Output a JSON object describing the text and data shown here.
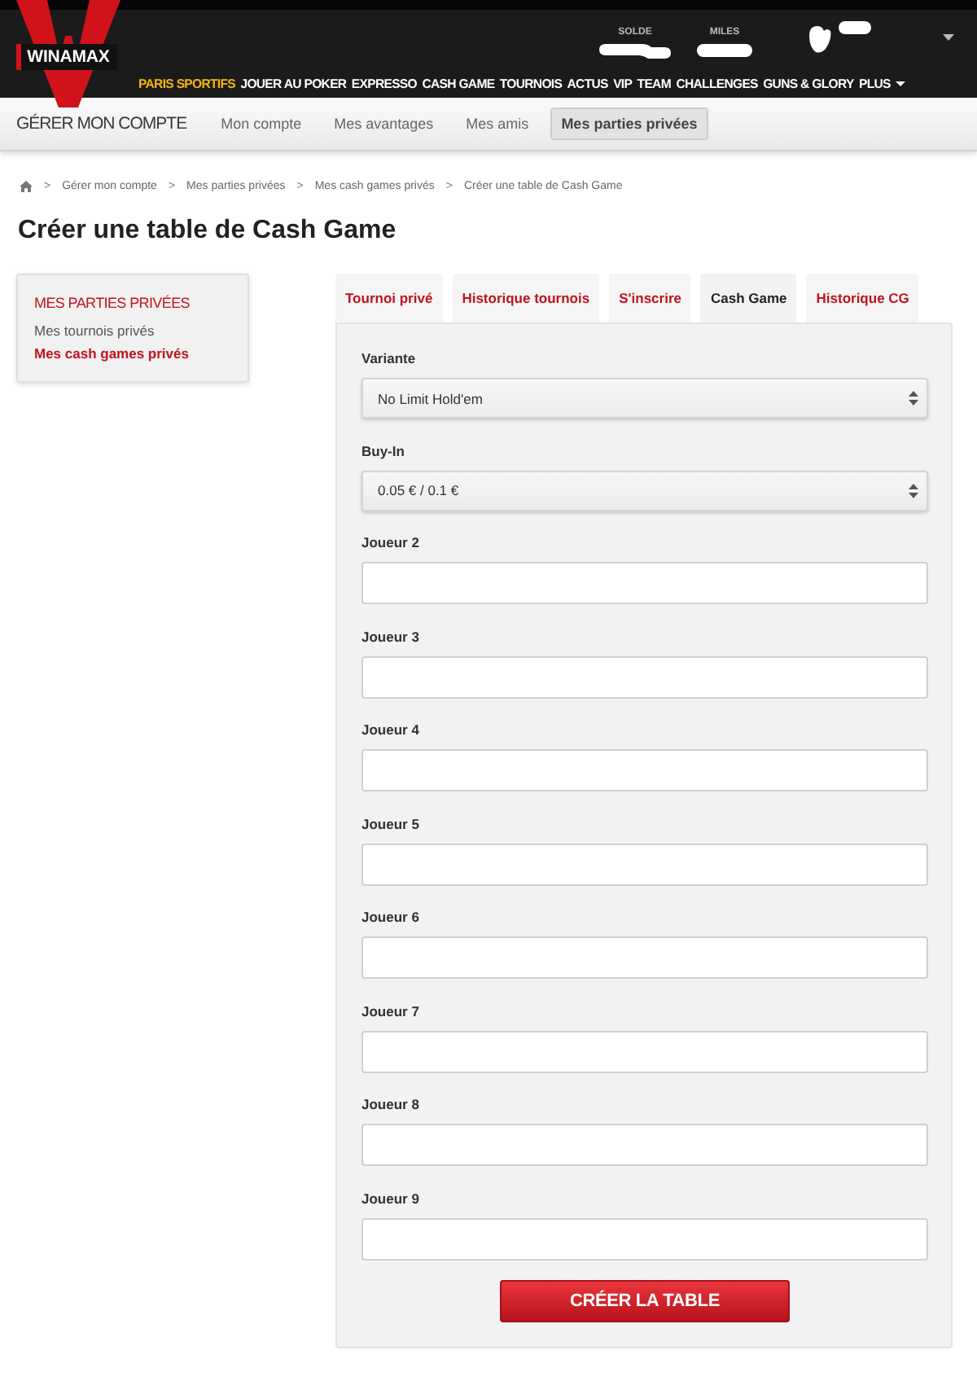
{
  "top_bar": {
    "logo": "WINAMAX",
    "account": [
      {
        "label": "SOLDE"
      },
      {
        "label": "MILES"
      }
    ],
    "nav": [
      {
        "label": "PARIS SPORTIFS",
        "selected": true,
        "dropdown": false
      },
      {
        "label": "JOUER AU POKER",
        "selected": false,
        "dropdown": false
      },
      {
        "label": "EXPRESSO",
        "selected": false,
        "dropdown": false
      },
      {
        "label": "CASH GAME",
        "selected": false,
        "dropdown": false
      },
      {
        "label": "TOURNOIS",
        "selected": false,
        "dropdown": false
      },
      {
        "label": "ACTUS",
        "selected": false,
        "dropdown": false
      },
      {
        "label": "VIP",
        "selected": false,
        "dropdown": false
      },
      {
        "label": "TEAM",
        "selected": false,
        "dropdown": false
      },
      {
        "label": "CHALLENGES",
        "selected": false,
        "dropdown": false
      },
      {
        "label": "GUNS & GLORY",
        "selected": false,
        "dropdown": false
      },
      {
        "label": "PLUS",
        "selected": false,
        "dropdown": true
      }
    ]
  },
  "account_nav": {
    "title": "GÉRER MON COMPTE",
    "items": [
      {
        "label": "Mon compte",
        "selected": false
      },
      {
        "label": "Mes avantages",
        "selected": false
      },
      {
        "label": "Mes amis",
        "selected": false
      },
      {
        "label": "Mes parties privées",
        "selected": true
      }
    ]
  },
  "breadcrumb": [
    {
      "kind": "home"
    },
    {
      "kind": "separator",
      "text": ">"
    },
    {
      "kind": "link",
      "text": "Gérer mon compte"
    },
    {
      "kind": "separator",
      "text": ">"
    },
    {
      "kind": "link",
      "text": "Mes parties privées"
    },
    {
      "kind": "separator",
      "text": ">"
    },
    {
      "kind": "link",
      "text": "Mes cash games privés"
    },
    {
      "kind": "separator",
      "text": ">"
    },
    {
      "kind": "current",
      "text": "Créer une table de Cash Game"
    }
  ],
  "page_title": "Créer une table de Cash Game",
  "sidebar": {
    "title": "MES PARTIES PRIVÉES",
    "items": [
      {
        "label": "Mes tournois privés",
        "selected": false
      },
      {
        "label": "Mes cash games privés",
        "selected": true
      }
    ]
  },
  "tabs": [
    {
      "label": "Tournoi privé",
      "selected": false
    },
    {
      "label": "Historique tournois",
      "selected": false
    },
    {
      "label": "S'inscrire",
      "selected": false
    },
    {
      "label": "Cash Game",
      "selected": true
    },
    {
      "label": "Historique CG",
      "selected": false
    }
  ],
  "form": {
    "fields": [
      {
        "kind": "select",
        "label": "Variante",
        "value": "No Limit Hold'em"
      },
      {
        "kind": "select",
        "label": "Buy-In",
        "value": "0.05 € / 0.1 €"
      },
      {
        "kind": "text",
        "label": "Joueur 2"
      },
      {
        "kind": "text",
        "label": "Joueur 3"
      },
      {
        "kind": "text",
        "label": "Joueur 4"
      },
      {
        "kind": "text",
        "label": "Joueur 5"
      },
      {
        "kind": "text",
        "label": "Joueur 6"
      },
      {
        "kind": "text",
        "label": "Joueur 7"
      },
      {
        "kind": "text",
        "label": "Joueur 8"
      },
      {
        "kind": "text",
        "label": "Joueur 9"
      }
    ],
    "submit": "CRÉER LA TABLE"
  }
}
